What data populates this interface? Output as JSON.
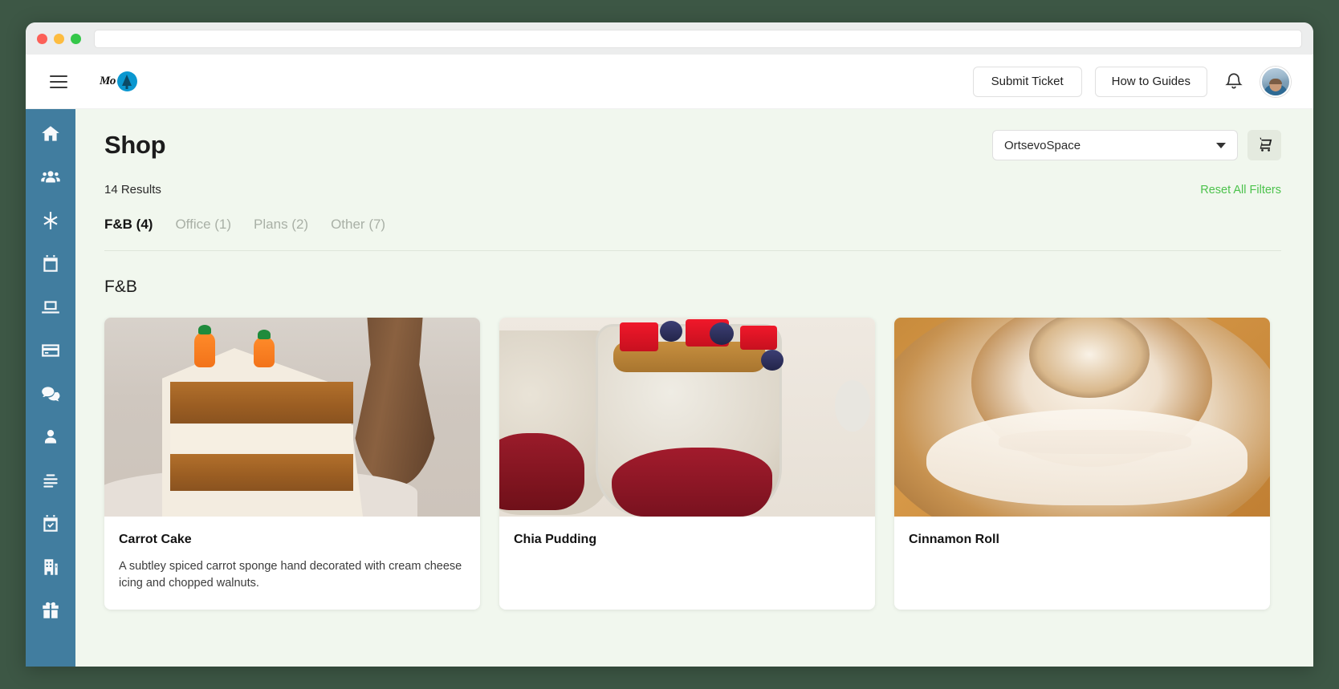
{
  "browser": {
    "url_value": "",
    "url_placeholder": ""
  },
  "header": {
    "logo_text": "Mo",
    "submit_ticket_label": "Submit Ticket",
    "how_to_guides_label": "How to Guides"
  },
  "sidebar": {
    "items": [
      {
        "icon": "home-icon",
        "name": "sidebar-item-home"
      },
      {
        "icon": "community-icon",
        "name": "sidebar-item-community"
      },
      {
        "icon": "asterisk-icon",
        "name": "sidebar-item-services"
      },
      {
        "icon": "calendar-icon",
        "name": "sidebar-item-calendar"
      },
      {
        "icon": "laptop-icon",
        "name": "sidebar-item-workspaces"
      },
      {
        "icon": "credit-card-icon",
        "name": "sidebar-item-billing"
      },
      {
        "icon": "chat-icon",
        "name": "sidebar-item-messages"
      },
      {
        "icon": "person-icon",
        "name": "sidebar-item-profile"
      },
      {
        "icon": "list-icon",
        "name": "sidebar-item-directory"
      },
      {
        "icon": "calendar-check-icon",
        "name": "sidebar-item-bookings"
      },
      {
        "icon": "building-icon",
        "name": "sidebar-item-locations"
      },
      {
        "icon": "gift-icon",
        "name": "sidebar-item-perks"
      }
    ]
  },
  "main": {
    "page_title": "Shop",
    "space_selector": {
      "selected": "OrtsevoSpace"
    },
    "results_count": "14 Results",
    "reset_filters_label": "Reset All Filters",
    "tabs": [
      {
        "label": "F&B (4)",
        "active": true
      },
      {
        "label": "Office (1)",
        "active": false
      },
      {
        "label": "Plans (2)",
        "active": false
      },
      {
        "label": "Other (7)",
        "active": false
      }
    ],
    "section_title": "F&B",
    "products": [
      {
        "title": "Carrot Cake",
        "description": "A subtley spiced carrot sponge hand decorated with cream cheese icing and chopped walnuts.",
        "image": "carrot-cake-photo"
      },
      {
        "title": "Chia Pudding",
        "description": "",
        "image": "chia-pudding-photo"
      },
      {
        "title": "Cinnamon Roll",
        "description": "",
        "image": "cinnamon-roll-photo"
      }
    ]
  },
  "colors": {
    "sidebar": "#417d9f",
    "content_bg": "#f1f7ee",
    "accent_green": "#4cc24c",
    "logo_blue": "#0a97d0",
    "cart_button_bg": "#e4eadf"
  }
}
